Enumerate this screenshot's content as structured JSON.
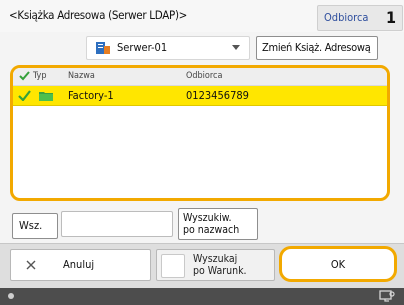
{
  "header": {
    "title": "<Książka Adresowa (Serwer LDAP)>",
    "recipient_label": "Odbiorca",
    "recipient_count": "1"
  },
  "server": {
    "selected": "Serwer-01",
    "icon": "server-icon",
    "change_label": "Zmień Książ. Adresową"
  },
  "list": {
    "columns": {
      "type": "Typ",
      "name": "Nazwa",
      "recipient": "Odbiorca"
    },
    "rows": [
      {
        "checked": true,
        "icon": "folder-icon",
        "name": "Factory-1",
        "recipient": "0123456789"
      }
    ]
  },
  "search": {
    "button_label": "Wsz.",
    "input_value": "",
    "by_name_label": "Wyszukiw.\npo nazwach"
  },
  "footer": {
    "cancel_label": "Anuluj",
    "condition_label": "Wyszukaj\npo Warunk.",
    "ok_label": "OK"
  },
  "colors": {
    "accent": "#f2a900",
    "selected_row": "#ffe600",
    "check": "#35a13b",
    "status_bar": "#4d4d4d"
  }
}
